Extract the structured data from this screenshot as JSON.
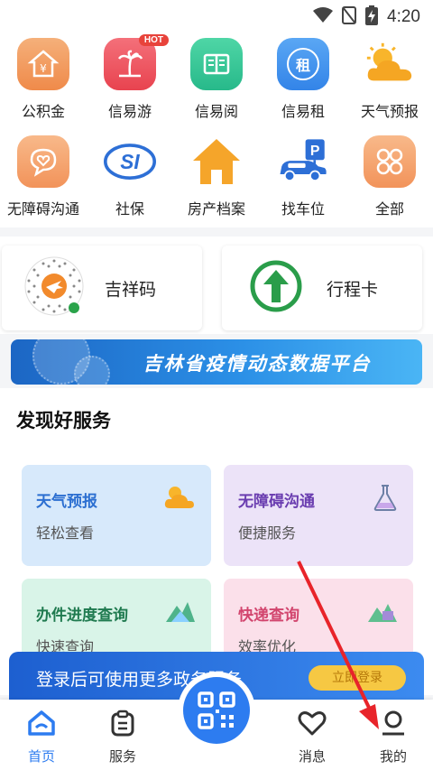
{
  "status_bar": {
    "time": "4:20"
  },
  "apps": [
    {
      "label": "公积金",
      "icon": "house-coin-icon"
    },
    {
      "label": "信易游",
      "icon": "palm-tree-icon",
      "badge": "HOT"
    },
    {
      "label": "信易阅",
      "icon": "book-icon"
    },
    {
      "label": "信易租",
      "icon": "rent-icon",
      "icon_text": "租"
    },
    {
      "label": "天气预报",
      "icon": "sun-cloud-icon"
    },
    {
      "label": "无障碍沟通",
      "icon": "chat-heart-icon"
    },
    {
      "label": "社保",
      "icon_text": "SI",
      "icon": "social-security-logo"
    },
    {
      "label": "房产档案",
      "icon": "house-icon"
    },
    {
      "label": "找车位",
      "icon": "parking-car-icon",
      "icon_text": "P"
    },
    {
      "label": "全部",
      "icon": "grid-all-icon"
    }
  ],
  "cards": {
    "jixiang": {
      "label": "吉祥码"
    },
    "xingcheng": {
      "label": "行程卡"
    }
  },
  "banner": {
    "text": "吉林省疫情动态数据平台"
  },
  "section": {
    "title": "发现好服务",
    "services": [
      {
        "title": "天气预报",
        "subtitle": "轻松查看",
        "icon": "sun-cloud-icon"
      },
      {
        "title": "无障碍沟通",
        "subtitle": "便捷服务",
        "icon": "flask-icon"
      },
      {
        "title": "办件进度查询",
        "subtitle": "快速查询",
        "icon": "mountain-chart-icon"
      },
      {
        "title": "快递查询",
        "subtitle": "效率优化",
        "icon": "parcel-icon"
      }
    ]
  },
  "login_bar": {
    "text": "登录后可使用更多政务服务",
    "button": "立即登录"
  },
  "tabs": [
    {
      "label": "首页",
      "icon": "home-icon"
    },
    {
      "label": "服务",
      "icon": "service-icon"
    },
    {
      "label": "消息",
      "icon": "heart-icon"
    },
    {
      "label": "我的",
      "icon": "user-icon"
    }
  ],
  "colors": {
    "accent": "#2d7cf0",
    "brand_green": "#2a9d4a",
    "banner_blue": "#1c66c4"
  }
}
